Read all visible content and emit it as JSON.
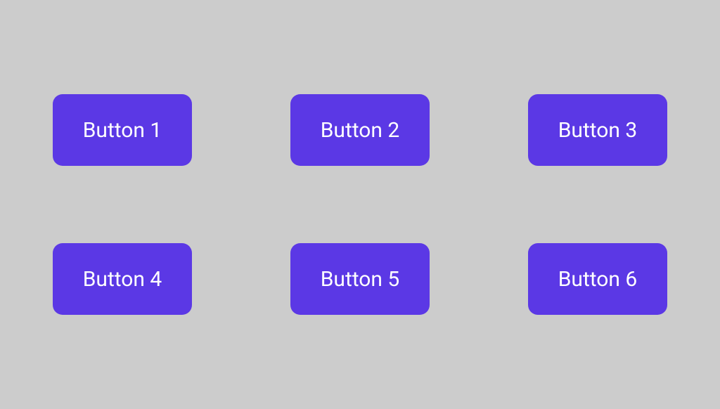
{
  "buttons": [
    {
      "label": "Button 1"
    },
    {
      "label": "Button 2"
    },
    {
      "label": "Button 3"
    },
    {
      "label": "Button 4"
    },
    {
      "label": "Button 5"
    },
    {
      "label": "Button 6"
    }
  ],
  "colors": {
    "background": "#cccccc",
    "button": "#5b38e5",
    "buttonText": "#ffffff"
  }
}
